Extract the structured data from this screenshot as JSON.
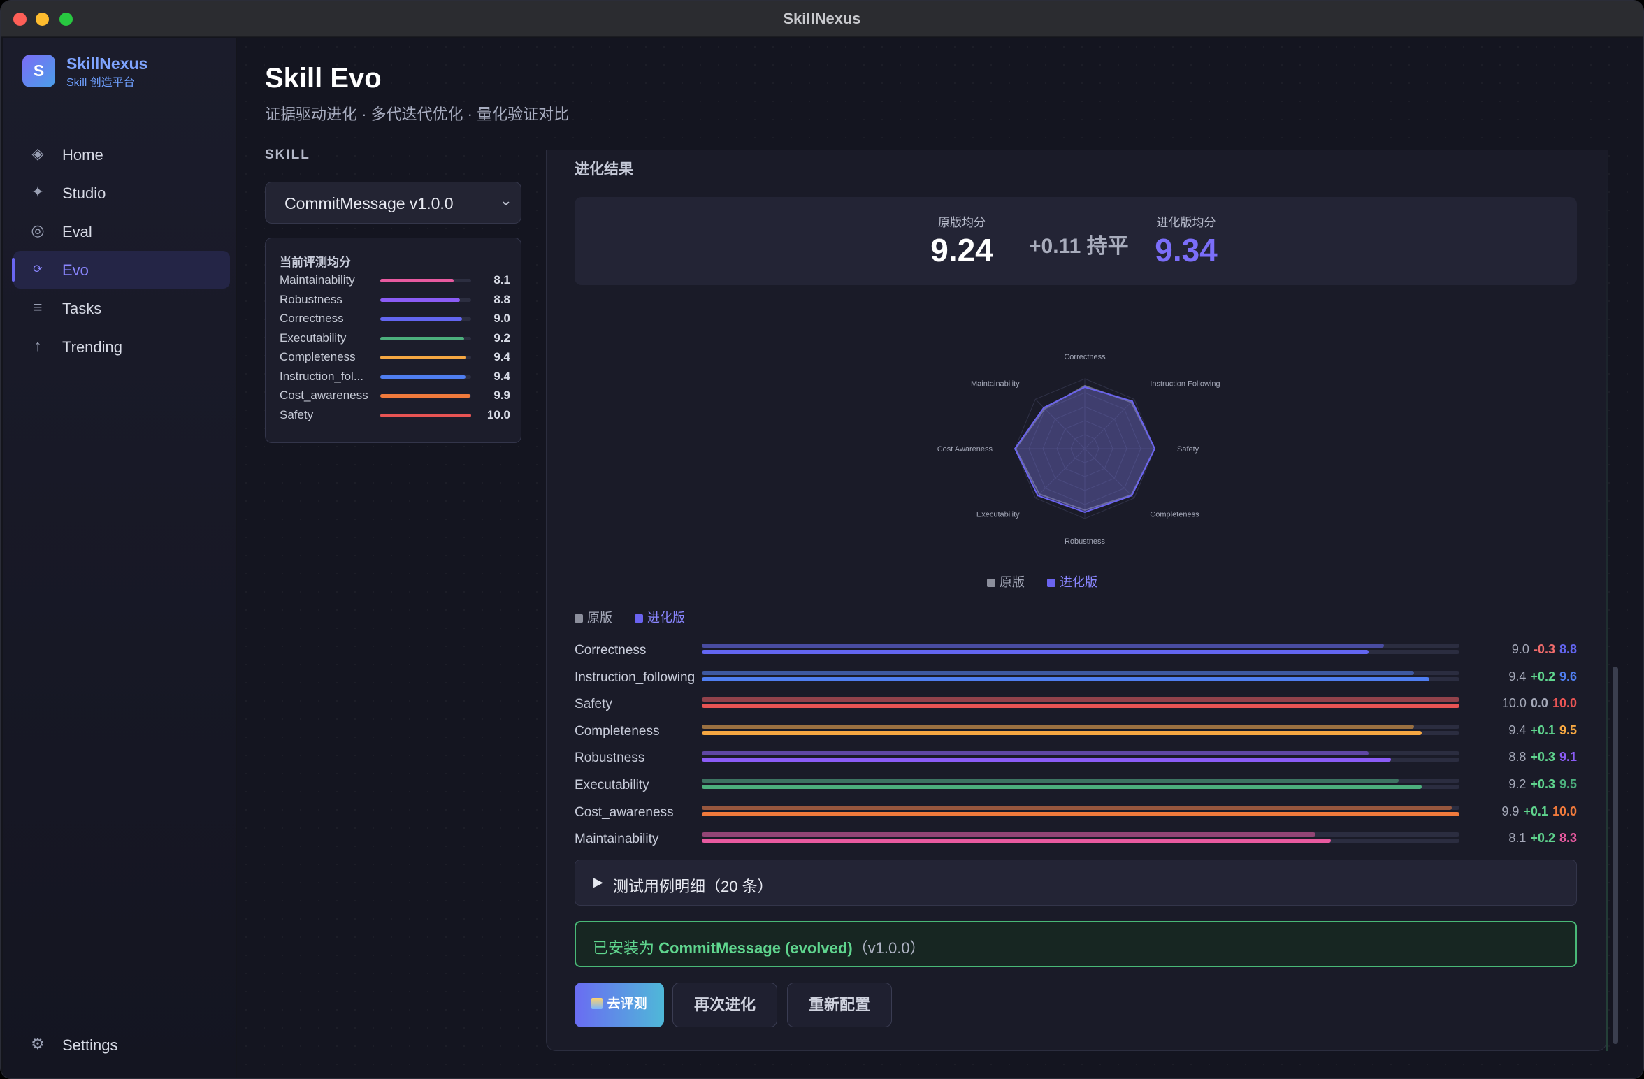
{
  "window": {
    "title": "SkillNexus"
  },
  "brand": {
    "logo_letter": "S",
    "name": "SkillNexus",
    "subtitle": "Skill 创造平台"
  },
  "nav": {
    "items": [
      {
        "label": "Home",
        "icon": "diamond-icon"
      },
      {
        "label": "Studio",
        "icon": "sparkle-icon"
      },
      {
        "label": "Eval",
        "icon": "target-icon"
      },
      {
        "label": "Evo",
        "icon": "refresh-icon",
        "active": true
      },
      {
        "label": "Tasks",
        "icon": "list-icon"
      },
      {
        "label": "Trending",
        "icon": "arrow-up-icon"
      }
    ],
    "settings_label": "Settings"
  },
  "page": {
    "title": "Skill Evo",
    "subtitle": "证据驱动进化 · 多代迭代优化 · 量化验证对比",
    "skill_label": "SKILL",
    "skill_selected": "CommitMessage v1.0.0"
  },
  "score_card": {
    "title": "当前评测均分",
    "rows": [
      {
        "name": "Maintainability",
        "value": "8.1",
        "fraction": 0.81,
        "color": "#e85aa0"
      },
      {
        "name": "Robustness",
        "value": "8.8",
        "fraction": 0.88,
        "color": "#8b5cf6"
      },
      {
        "name": "Correctness",
        "value": "9.0",
        "fraction": 0.9,
        "color": "#6366f1"
      },
      {
        "name": "Executability",
        "value": "9.2",
        "fraction": 0.92,
        "color": "#4caf7d"
      },
      {
        "name": "Completeness",
        "value": "9.4",
        "fraction": 0.94,
        "color": "#f5a742"
      },
      {
        "name": "Instruction_fol...",
        "value": "9.4",
        "fraction": 0.94,
        "color": "#4f7ef0"
      },
      {
        "name": "Cost_awareness",
        "value": "9.9",
        "fraction": 0.99,
        "color": "#f07a3c"
      },
      {
        "name": "Safety",
        "value": "10.0",
        "fraction": 1.0,
        "color": "#e85454"
      }
    ]
  },
  "results": {
    "title": "进化结果",
    "original_label": "原版均分",
    "original_value": "9.24",
    "delta_text": "+0.11 持平",
    "evolved_label": "进化版均分",
    "evolved_value": "9.34",
    "legend_original": "原版",
    "legend_evolved": "进化版",
    "original_color": "#8c8f9c",
    "evolved_color": "#6a63f0"
  },
  "radar": {
    "axes": [
      "Correctness",
      "Instruction Following",
      "Safety",
      "Completeness",
      "Robustness",
      "Executability",
      "Cost Awareness",
      "Maintainability"
    ],
    "original": [
      9.0,
      9.4,
      10.0,
      9.4,
      8.8,
      9.2,
      9.9,
      8.1
    ],
    "evolved": [
      8.8,
      9.6,
      10.0,
      9.5,
      9.1,
      9.5,
      10.0,
      8.3
    ],
    "max": 10
  },
  "comparison": [
    {
      "name": "Correctness",
      "original": "9.0",
      "delta": "-0.3",
      "evolved": "8.8",
      "o": 0.9,
      "e": 0.88,
      "color": "#6366f1",
      "delta_color": "#ef6b6b"
    },
    {
      "name": "Instruction_following",
      "original": "9.4",
      "delta": "+0.2",
      "evolved": "9.6",
      "o": 0.94,
      "e": 0.96,
      "color": "#4f7ef0",
      "delta_color": "#5fd58e"
    },
    {
      "name": "Safety",
      "original": "10.0",
      "delta": "0.0",
      "evolved": "10.0",
      "o": 1.0,
      "e": 1.0,
      "color": "#e85454",
      "delta_color": "#a4a8b8"
    },
    {
      "name": "Completeness",
      "original": "9.4",
      "delta": "+0.1",
      "evolved": "9.5",
      "o": 0.94,
      "e": 0.95,
      "color": "#f5a742",
      "delta_color": "#5fd58e"
    },
    {
      "name": "Robustness",
      "original": "8.8",
      "delta": "+0.3",
      "evolved": "9.1",
      "o": 0.88,
      "e": 0.91,
      "color": "#8b5cf6",
      "delta_color": "#5fd58e"
    },
    {
      "name": "Executability",
      "original": "9.2",
      "delta": "+0.3",
      "evolved": "9.5",
      "o": 0.92,
      "e": 0.95,
      "color": "#4caf7d",
      "delta_color": "#5fd58e"
    },
    {
      "name": "Cost_awareness",
      "original": "9.9",
      "delta": "+0.1",
      "evolved": "10.0",
      "o": 0.99,
      "e": 1.0,
      "color": "#f07a3c",
      "delta_color": "#5fd58e"
    },
    {
      "name": "Maintainability",
      "original": "8.1",
      "delta": "+0.2",
      "evolved": "8.3",
      "o": 0.81,
      "e": 0.83,
      "color": "#e85aa0",
      "delta_color": "#5fd58e"
    }
  ],
  "details": {
    "toggle": "▶",
    "label": "测试用例明细（20 条）"
  },
  "install": {
    "prefix": "已安装为 ",
    "name": "CommitMessage (evolved)",
    "version": "（v1.0.0）"
  },
  "actions": {
    "eval": "去评测",
    "evolve_again": "再次进化",
    "reconfigure": "重新配置"
  }
}
